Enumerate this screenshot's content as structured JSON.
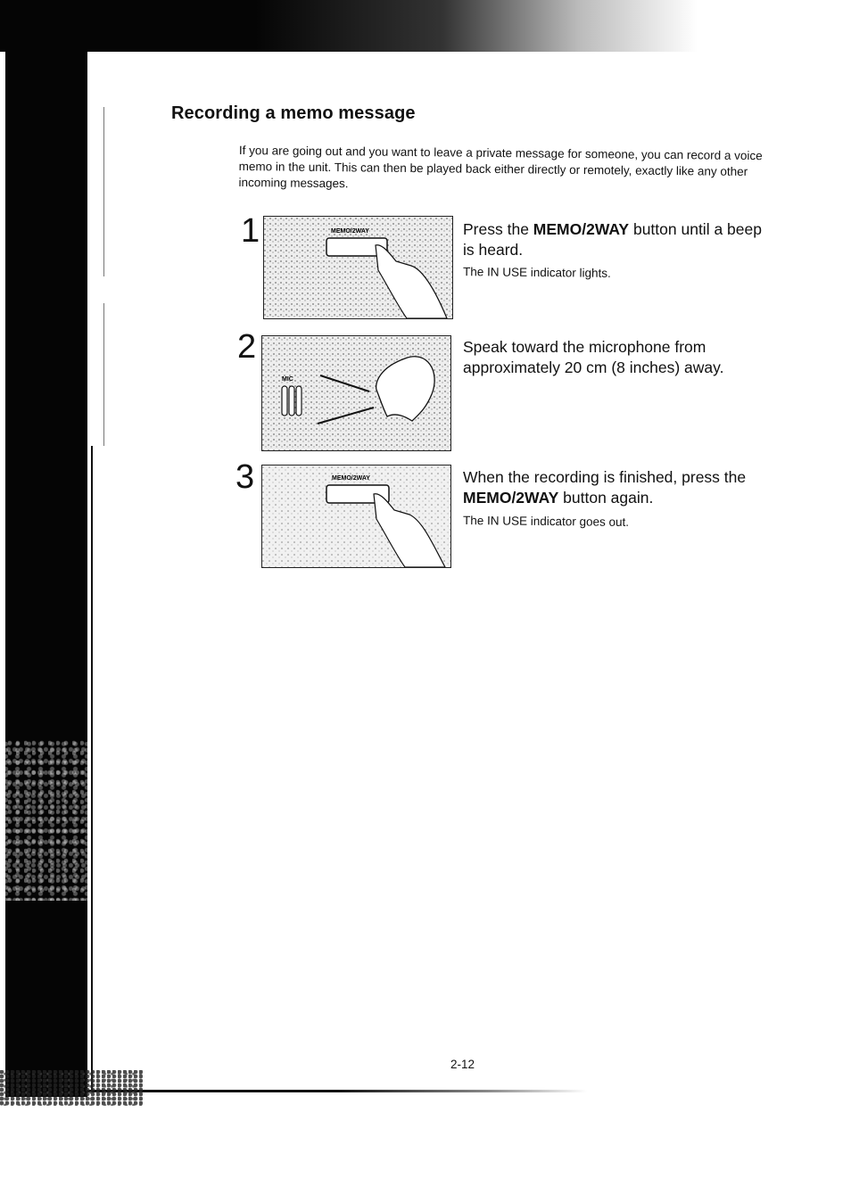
{
  "page": {
    "title": "Recording a memo message",
    "intro": "If you are going out and you want to leave a private message for someone, you can record a voice memo in the unit. This can then be played back either directly or remotely, exactly like any other incoming messages.",
    "page_number": "2-12"
  },
  "steps": [
    {
      "number": "1",
      "illustration": {
        "label": "MEMO/2WAY",
        "depicts": "finger pressing MEMO/2WAY button"
      },
      "main_prefix": "Press the ",
      "main_bold": "MEMO/2WAY",
      "main_suffix": " button until a beep is heard.",
      "note": "The IN USE indicator lights."
    },
    {
      "number": "2",
      "illustration": {
        "label": "MIC",
        "depicts": "person speaking toward microphone"
      },
      "main_prefix": "Speak toward the microphone from approximately 20 cm (8 inches) away.",
      "main_bold": "",
      "main_suffix": "",
      "note": ""
    },
    {
      "number": "3",
      "illustration": {
        "label": "MEMO/2WAY",
        "depicts": "finger pressing MEMO/2WAY button"
      },
      "main_prefix": "When the recording is finished, press the ",
      "main_bold": "MEMO/2WAY",
      "main_suffix": " button again.",
      "note": "The IN USE indicator goes out."
    }
  ]
}
